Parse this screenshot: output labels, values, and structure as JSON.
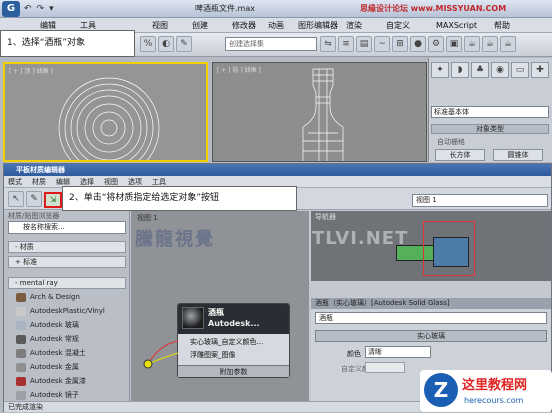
{
  "window": {
    "doc_title": "啤酒瓶文件.max",
    "watermark_top": "思缘设计论坛 www.MISSYUAN.COM",
    "qat": [
      "↶",
      "↷",
      "▾"
    ]
  },
  "menubar": [
    "编辑",
    "工具",
    "视图",
    "创建",
    "修改器",
    "动画",
    "图形编辑器",
    "渲染",
    "自定义",
    "MAXScript",
    "帮助"
  ],
  "toolbar": {
    "selection_set_placeholder": "创建选择集"
  },
  "callout1": "1、选择“酒瓶”对象",
  "callout2": "2、单击“将材质指定给选定对象”按钮",
  "viewports": {
    "left_label": "[ + ] 顶 ] 线框 ]",
    "right_label": "[ + ] 前 ] 线框 ]"
  },
  "command_panel": {
    "dropdown": "标准基本体",
    "rollout": "对象类型",
    "auto_grid": "自动栅格",
    "btn1": "长方体",
    "btn2": "圆锥体"
  },
  "sme": {
    "title": "平板材质编辑器",
    "menu": [
      "模式",
      "材质",
      "编辑",
      "选择",
      "视图",
      "选项",
      "工具"
    ],
    "view_dropdown": "视图 1",
    "browser_label": "材质/贴图浏览器",
    "search_placeholder": "按名称搜索...",
    "cat_material": "- 材质",
    "cat_standard": "+ 标准",
    "cat_mentalray": "- mental ray",
    "items": [
      {
        "label": "Arch & Design",
        "color": "#7a5c40"
      },
      {
        "label": "AutodeskPlastic/Vinyl",
        "color": "#c9c9c9"
      },
      {
        "label": "Autodesk 玻璃",
        "color": "#aab4c0"
      },
      {
        "label": "Autodesk 常规",
        "color": "#5a5a5a"
      },
      {
        "label": "Autodesk 混凝土",
        "color": "#7d7d7d"
      },
      {
        "label": "Autodesk 金属",
        "color": "#8f8f8f"
      },
      {
        "label": "Autodesk 金属漆",
        "color": "#a83030"
      },
      {
        "label": "Autodesk 镜子",
        "color": "#9aa0a6"
      }
    ],
    "view1_label": "视图 1",
    "node": {
      "name": "酒瓶",
      "type": "Autodesk...",
      "slot1": "实心玻璃_自定义颜色...",
      "slot2": "浮雕图案_图像",
      "extra": "附加参数"
    },
    "navigator_label": "导航器",
    "params_title": "酒瓶（实心玻璃）[Autodesk Solid Glass]",
    "mat_name": "酒瓶",
    "rollout_solid": "实心玻璃",
    "color_label": "颜色",
    "color_value": "清晰",
    "custom_color_label": "自定义颜色",
    "status": "已完成渲染"
  },
  "watermarks": {
    "center": "騰龍視覺",
    "right": "TLVI.NET"
  },
  "site": {
    "mark": "Z",
    "title": "这里教程网",
    "url": "herecours.com"
  }
}
